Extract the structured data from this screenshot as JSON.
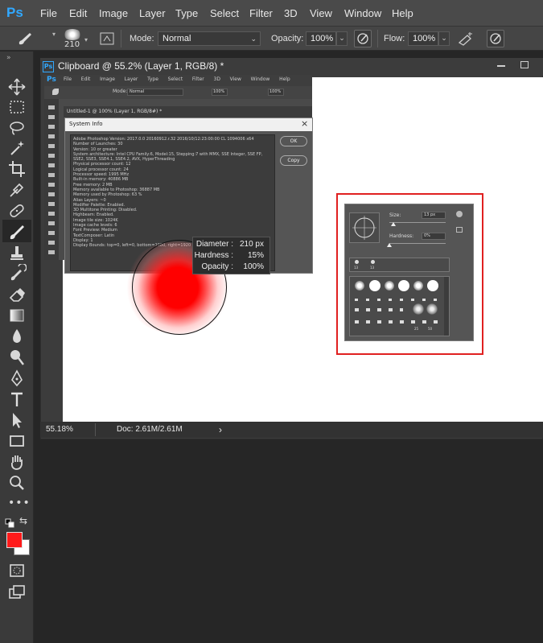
{
  "app": {
    "logo": "Ps"
  },
  "menu": [
    "File",
    "Edit",
    "Image",
    "Layer",
    "Type",
    "Select",
    "Filter",
    "3D",
    "View",
    "Window",
    "Help"
  ],
  "options": {
    "brush_size": "210",
    "mode_label": "Mode:",
    "mode_value": "Normal",
    "opacity_label": "Opacity:",
    "opacity_value": "100%",
    "flow_label": "Flow:",
    "flow_value": "100%"
  },
  "document": {
    "tab_title": "Clipboard @ 55.2% (Layer 1, RGB/8) *",
    "zoom": "55.18%",
    "doc_info": "Doc: 2.61M/2.61M",
    "status_arrow": "›"
  },
  "embedded": {
    "logo": "Ps",
    "menu": [
      "File",
      "Edit",
      "Image",
      "Layer",
      "Type",
      "Select",
      "Filter",
      "3D",
      "View",
      "Window",
      "Help"
    ],
    "mode_value": "Normal",
    "opacity_value": "100%",
    "flow_value": "100%",
    "tab_title": "Untitled-1 @ 100% (Layer 1, RGB/8#) *",
    "dialog_title": "System Info",
    "ok": "OK",
    "copy": "Copy",
    "info_lines": [
      "Adobe Photoshop Version: 2017.0.0 20160912.r.32 2016/10/12:23:00:00 CL 1094006  x64",
      "Number of Launches: 30",
      "Version: 10 or greater",
      "System architecture: Intel CPU Family:6, Model:15, Stepping:7 with MMX, SSE Integer, SSE FP,",
      "SSE2, SSE3, SSE4.1, SSE4.2, AVX, HyperThreading",
      "Physical processor count: 12",
      "Logical processor count: 24",
      "Processor speed: 1995 MHz",
      "Built-in memory: 40886 MB",
      "Free memory: 2 MB",
      "Memory available to Photoshop: 36887 MB",
      "Memory used by Photoshop: 63 %",
      "Alias Layers: ~0",
      "Modifier Palette: Enabled.",
      "3D Multitone Printing: Disabled.",
      "Highbeam: Enabled.",
      "Image tile size: 1024K",
      "Image cache levels: 6",
      "Font Preview: Medium",
      "TextComposer: Latin",
      "Display: 1",
      "Display Bounds: top=0, left=0, bottom=1080, right=1920"
    ],
    "brush_size_label": "Size:",
    "brush_size_value": "13 px",
    "brush_hardness_label": "Hardness:",
    "brush_hardness_value": "0%",
    "preset_a": "13",
    "preset_b": "13",
    "row_nums": [
      "25",
      "50"
    ]
  },
  "hud": {
    "diameter_label": "Diameter :",
    "diameter_value": "210 px",
    "hardness_label": "Hardness :",
    "hardness_value": "15%",
    "opacity_label": "Opacity :",
    "opacity_value": "100%"
  },
  "colors": {
    "foreground": "#ff1a1a",
    "background": "#ffffff",
    "highlight_box": "#e02020",
    "accent": "#31a8ff"
  }
}
